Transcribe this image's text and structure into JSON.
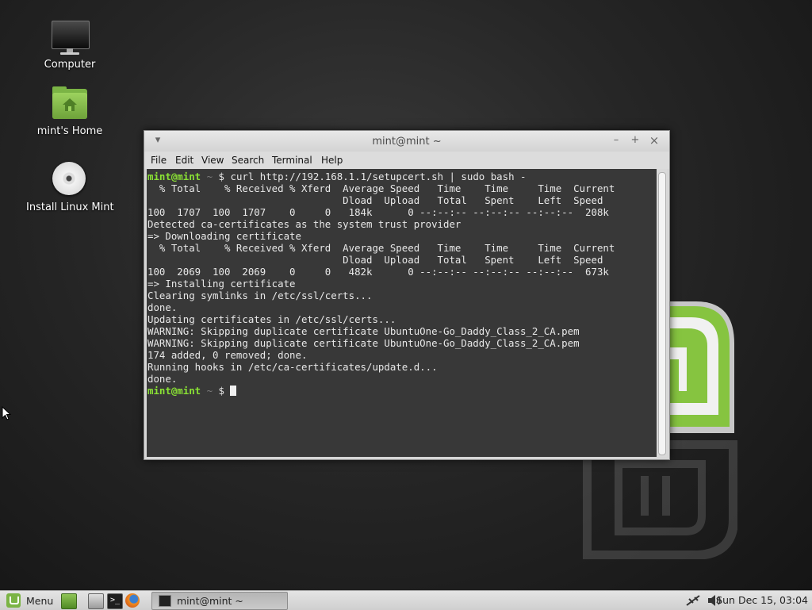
{
  "desktop": {
    "icons": [
      {
        "label": "Computer"
      },
      {
        "label": "mint's Home"
      },
      {
        "label": "Install Linux Mint"
      }
    ]
  },
  "window": {
    "title": "mint@mint ~",
    "controls": {
      "menu": "▾",
      "minimize": "–",
      "maximize": "+",
      "close": "×"
    },
    "menu": [
      "File",
      "Edit",
      "View",
      "Search",
      "Terminal",
      "Help"
    ]
  },
  "terminal": {
    "prompt_user": "mint@mint",
    "prompt_path": "~",
    "prompt_symbol": "$",
    "command": "curl http://192.168.1.1/setupcert.sh | sudo bash -",
    "output": [
      "  % Total    % Received % Xferd  Average Speed   Time    Time     Time  Current",
      "                                 Dload  Upload   Total   Spent    Left  Speed",
      "100  1707  100  1707    0     0   184k      0 --:--:-- --:--:-- --:--:--  208k",
      "Detected ca-certificates as the system trust provider",
      "=> Downloading certificate",
      "  % Total    % Received % Xferd  Average Speed   Time    Time     Time  Current",
      "                                 Dload  Upload   Total   Spent    Left  Speed",
      "100  2069  100  2069    0     0   482k      0 --:--:-- --:--:-- --:--:--  673k",
      "=> Installing certificate",
      "Clearing symlinks in /etc/ssl/certs...",
      "done.",
      "Updating certificates in /etc/ssl/certs...",
      "WARNING: Skipping duplicate certificate UbuntuOne-Go_Daddy_Class_2_CA.pem",
      "WARNING: Skipping duplicate certificate UbuntuOne-Go_Daddy_Class_2_CA.pem",
      "174 added, 0 removed; done.",
      "Running hooks in /etc/ca-certificates/update.d...",
      "done."
    ]
  },
  "taskbar": {
    "menu_label": "Menu",
    "task_label": "mint@mint ~",
    "clock": "Sun Dec 15, 03:04"
  },
  "colors": {
    "prompt": "#8ae234",
    "terminal_bg": "#383838",
    "mint_green": "#7bb445"
  }
}
